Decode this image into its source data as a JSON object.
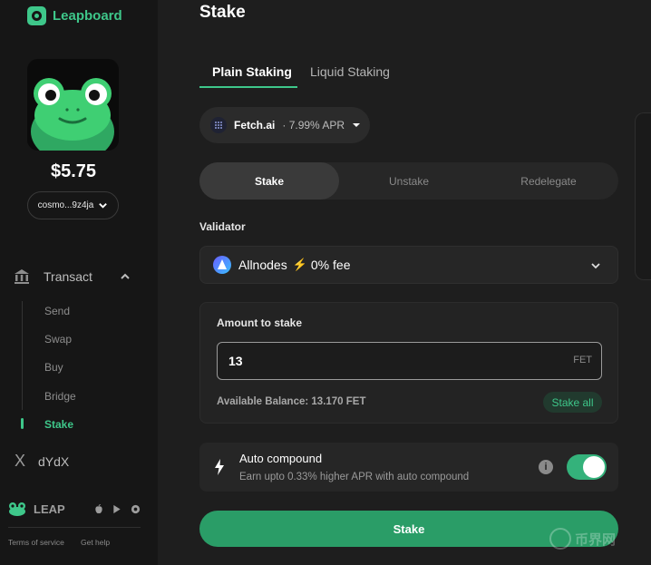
{
  "sidebar": {
    "brand": "Leapboard",
    "balance": "$5.75",
    "wallet_address": "cosmo...9z4ja",
    "nav": {
      "section_label": "Transact",
      "items": [
        {
          "label": "Send",
          "active": false
        },
        {
          "label": "Swap",
          "active": false
        },
        {
          "label": "Buy",
          "active": false
        },
        {
          "label": "Bridge",
          "active": false
        },
        {
          "label": "Stake",
          "active": true
        }
      ],
      "dydx_label": "dYdX"
    },
    "leap_label": "LEAP",
    "footer": {
      "terms": "Terms of service",
      "help": "Get help"
    }
  },
  "main": {
    "title": "Stake",
    "tabs": [
      {
        "label": "Plain Staking",
        "active": true
      },
      {
        "label": "Liquid Staking",
        "active": false
      }
    ],
    "chain": {
      "name": "Fetch.ai",
      "apr": "· 7.99% APR"
    },
    "segments": [
      {
        "label": "Stake",
        "active": true
      },
      {
        "label": "Unstake",
        "active": false
      },
      {
        "label": "Redelegate",
        "active": false
      }
    ],
    "validator": {
      "label": "Validator",
      "name": "Allnodes",
      "fee": "0% fee"
    },
    "amount": {
      "label": "Amount to stake",
      "value": "13",
      "unit": "FET",
      "available": "Available Balance: 13.170 FET",
      "stake_all": "Stake all"
    },
    "auto_compound": {
      "title": "Auto compound",
      "subtitle": "Earn upto 0.33% higher APR with auto compound",
      "enabled": true
    },
    "submit_label": "Stake"
  },
  "watermark": "币界网",
  "colors": {
    "accent": "#3ec78a",
    "button": "#2a9d67",
    "background": "#1e1e1e",
    "sidebar": "#161616"
  }
}
